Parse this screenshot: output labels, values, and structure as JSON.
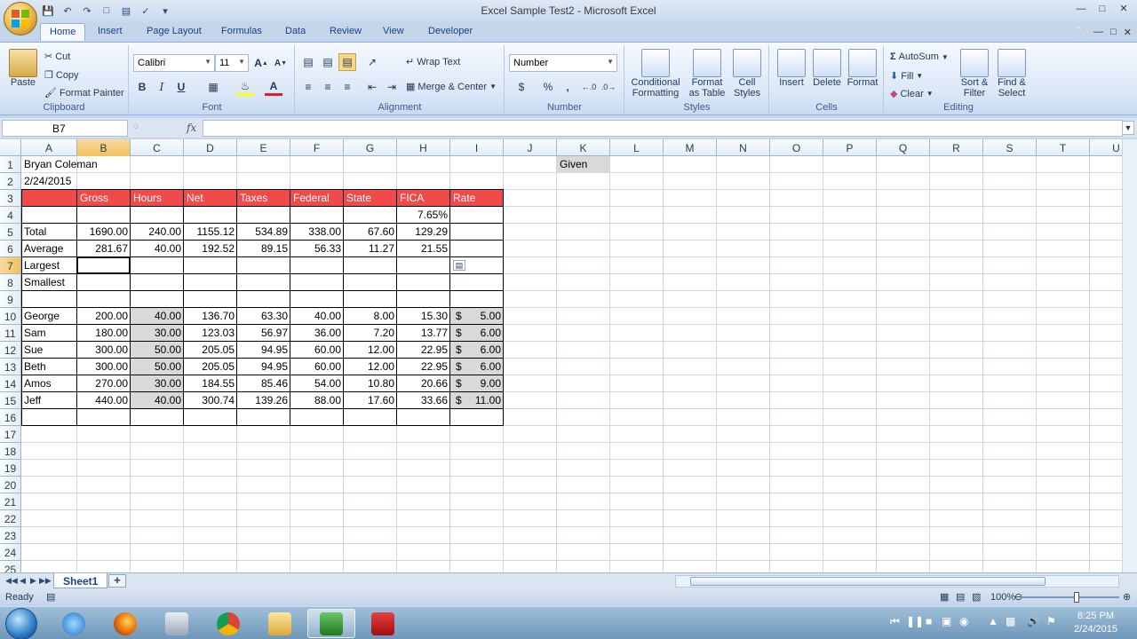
{
  "window": {
    "title": "Excel Sample Test2 - Microsoft Excel"
  },
  "ribbon": {
    "tabs": [
      "Home",
      "Insert",
      "Page Layout",
      "Formulas",
      "Data",
      "Review",
      "View",
      "Developer"
    ],
    "active_tab": "Home",
    "clipboard": {
      "paste": "Paste",
      "cut": "Cut",
      "copy": "Copy",
      "format_painter": "Format Painter",
      "label": "Clipboard"
    },
    "font": {
      "name": "Calibri",
      "size": "11",
      "bold": "B",
      "italic": "I",
      "underline": "U",
      "grow": "A",
      "shrink": "A",
      "font_color": "A",
      "label": "Font"
    },
    "alignment": {
      "wrap_text": "Wrap Text",
      "merge_center": "Merge & Center",
      "label": "Alignment"
    },
    "number": {
      "format": "Number",
      "currency": "$",
      "percent": "%",
      "comma": ",",
      "label": "Number"
    },
    "styles": {
      "conditional_formatting": [
        "Conditional",
        "Formatting"
      ],
      "format_as_table": [
        "Format",
        "as Table"
      ],
      "cell_styles": [
        "Cell",
        "Styles"
      ],
      "label": "Styles"
    },
    "cells": {
      "insert": "Insert",
      "delete": "Delete",
      "format": "Format",
      "label": "Cells"
    },
    "editing": {
      "autosum": "AutoSum",
      "fill": "Fill",
      "clear": "Clear",
      "sort_filter": [
        "Sort &",
        "Filter"
      ],
      "find_select": [
        "Find &",
        "Select"
      ],
      "label": "Editing"
    }
  },
  "formula_bar": {
    "name_box": "B7",
    "fx": "fx",
    "formula": ""
  },
  "grid": {
    "columns": [
      "A",
      "B",
      "C",
      "D",
      "E",
      "F",
      "G",
      "H",
      "I",
      "J",
      "K",
      "L",
      "M",
      "N",
      "O",
      "P",
      "Q",
      "R",
      "S",
      "T",
      "U"
    ],
    "selected_column": "B",
    "selected_row": "7",
    "rows": [
      "1",
      "2",
      "3",
      "4",
      "5",
      "6",
      "7",
      "8",
      "9",
      "10",
      "11",
      "12",
      "13",
      "14",
      "15",
      "16",
      "17",
      "18",
      "19",
      "20",
      "21",
      "22",
      "23",
      "24",
      "25"
    ],
    "cells": {
      "A1": "Bryan Coleman",
      "A2": "2/24/2015",
      "B3": "Gross",
      "C3": "Hours",
      "D3": "Net",
      "E3": "Taxes",
      "F3": "Federal",
      "G3": "State",
      "H3": "FICA",
      "I3": "Rate",
      "H4": "7.65%",
      "A5": "Total",
      "B5": "1690.00",
      "C5": "240.00",
      "D5": "1155.12",
      "E5": "534.89",
      "F5": "338.00",
      "G5": "67.60",
      "H5": "129.29",
      "A6": "Average",
      "B6": "281.67",
      "C6": "40.00",
      "D6": "192.52",
      "E6": "89.15",
      "F6": "56.33",
      "G6": "11.27",
      "H6": "21.55",
      "A7": "Largest",
      "A8": "Smallest",
      "A10": "George",
      "B10": "200.00",
      "C10": "40.00",
      "D10": "136.70",
      "E10": "63.30",
      "F10": "40.00",
      "G10": "8.00",
      "H10": "15.30",
      "I10": "5.00",
      "A11": "Sam",
      "B11": "180.00",
      "C11": "30.00",
      "D11": "123.03",
      "E11": "56.97",
      "F11": "36.00",
      "G11": "7.20",
      "H11": "13.77",
      "I11": "6.00",
      "A12": "Sue",
      "B12": "300.00",
      "C12": "50.00",
      "D12": "205.05",
      "E12": "94.95",
      "F12": "60.00",
      "G12": "12.00",
      "H12": "22.95",
      "I12": "6.00",
      "A13": "Beth",
      "B13": "300.00",
      "C13": "50.00",
      "D13": "205.05",
      "E13": "94.95",
      "F13": "60.00",
      "G13": "12.00",
      "H13": "22.95",
      "I13": "6.00",
      "A14": "Amos",
      "B14": "270.00",
      "C14": "30.00",
      "D14": "184.55",
      "E14": "85.46",
      "F14": "54.00",
      "G14": "10.80",
      "H14": "20.66",
      "I14": "9.00",
      "A15": "Jeff",
      "B15": "440.00",
      "C15": "40.00",
      "D15": "300.74",
      "E15": "139.26",
      "F15": "88.00",
      "G15": "17.60",
      "H15": "33.66",
      "I15": "11.00",
      "K1": "Given"
    },
    "currency_symbol": "$"
  },
  "sheets": {
    "tabs": [
      "Sheet1"
    ]
  },
  "status": {
    "ready": "Ready",
    "zoom": "100%"
  },
  "taskbar": {
    "time": "8:25 PM",
    "date": "2/24/2015"
  },
  "colors": {
    "header_red": "#f04a4a",
    "grey_fill": "#d9d9d9",
    "selection_orange": "#f1c15f"
  }
}
